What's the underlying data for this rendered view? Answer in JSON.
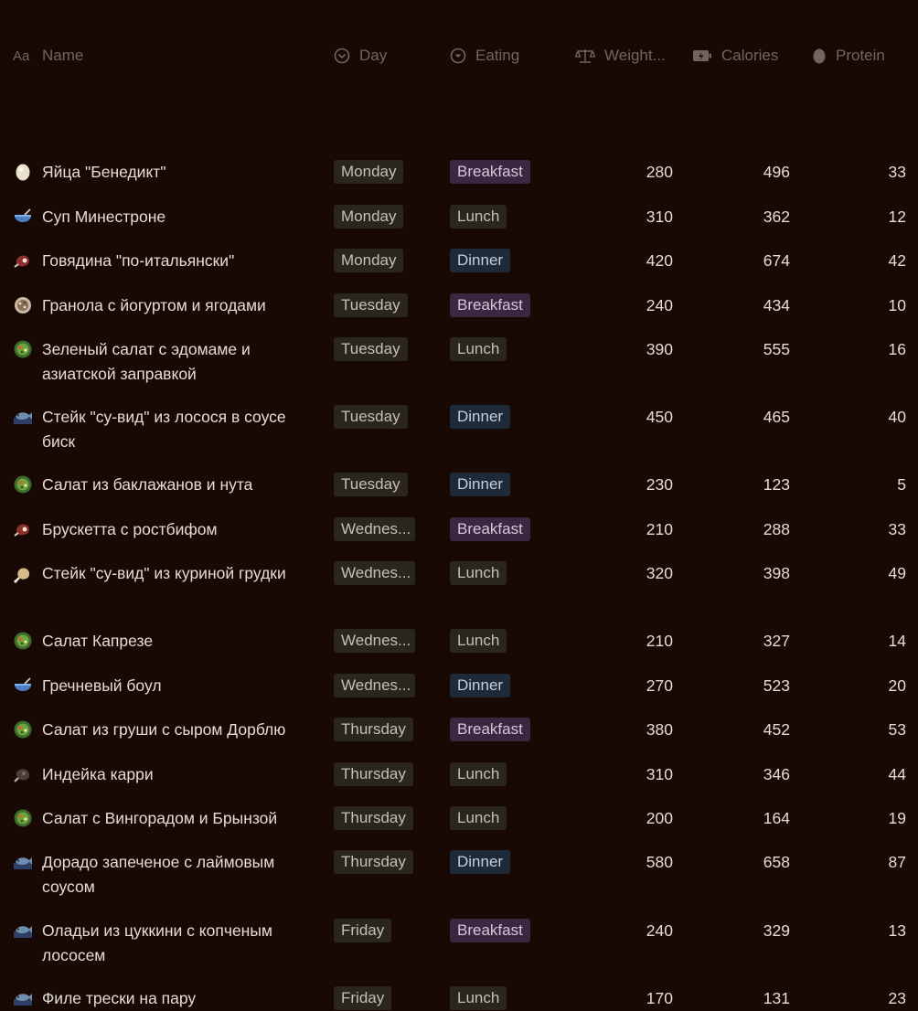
{
  "header": {
    "name": "Name",
    "day": "Day",
    "eating": "Eating",
    "weight": "Weight...",
    "calories": "Calories",
    "protein": "Protein"
  },
  "rows": [
    {
      "name": "Яйца \"Бенедикт\"",
      "icon": "egg-icon",
      "day": "Monday",
      "eating": "Breakfast",
      "weight": "280",
      "calories": "496",
      "protein": "33"
    },
    {
      "name": "Суп Минестроне",
      "icon": "soup-bowl-icon",
      "day": "Monday",
      "eating": "Lunch",
      "weight": "310",
      "calories": "362",
      "protein": "12"
    },
    {
      "name": "Говядина \"по-итальянски\"",
      "icon": "meat-icon",
      "day": "Monday",
      "eating": "Dinner",
      "weight": "420",
      "calories": "674",
      "protein": "42"
    },
    {
      "name": "Гранола с йогуртом и ягодами",
      "icon": "granola-icon",
      "day": "Tuesday",
      "eating": "Breakfast",
      "weight": "240",
      "calories": "434",
      "protein": "10"
    },
    {
      "name": "Зеленый салат с эдомаме и азиатской заправкой",
      "icon": "salad-icon",
      "day": "Tuesday",
      "eating": "Lunch",
      "weight": "390",
      "calories": "555",
      "protein": "16"
    },
    {
      "name": "Стейк \"су-вид\" из лосося в соусе биск",
      "icon": "fish-icon",
      "day": "Tuesday",
      "eating": "Dinner",
      "weight": "450",
      "calories": "465",
      "protein": "40"
    },
    {
      "name": "Салат из баклажанов и нута",
      "icon": "salad-icon",
      "day": "Tuesday",
      "eating": "Dinner",
      "weight": "230",
      "calories": "123",
      "protein": "5"
    },
    {
      "name": "Брускетта с ростбифом",
      "icon": "meat-icon",
      "day": "Wednes...",
      "eating": "Breakfast",
      "weight": "210",
      "calories": "288",
      "protein": "33"
    },
    {
      "name": "Стейк \"су-вид\" из куриной грудки",
      "icon": "chicken-icon",
      "day": "Wednes...",
      "eating": "Lunch",
      "weight": "320",
      "calories": "398",
      "protein": "49"
    },
    {
      "name": "Салат Капрезе",
      "icon": "salad-icon",
      "day": "Wednes...",
      "eating": "Lunch",
      "weight": "210",
      "calories": "327",
      "protein": "14"
    },
    {
      "name": "Гречневый боул",
      "icon": "soup-bowl-icon",
      "day": "Wednes...",
      "eating": "Dinner",
      "weight": "270",
      "calories": "523",
      "protein": "20"
    },
    {
      "name": "Салат из груши с сыром Дорблю",
      "icon": "salad-icon",
      "day": "Thursday",
      "eating": "Breakfast",
      "weight": "380",
      "calories": "452",
      "protein": "53"
    },
    {
      "name": "Индейка карри",
      "icon": "turkey-icon",
      "day": "Thursday",
      "eating": "Lunch",
      "weight": "310",
      "calories": "346",
      "protein": "44"
    },
    {
      "name": "Салат с Вингорадом и Брынзой",
      "icon": "salad-icon",
      "day": "Thursday",
      "eating": "Lunch",
      "weight": "200",
      "calories": "164",
      "protein": "19"
    },
    {
      "name": "Дорадо запеченое с лаймовым соусом",
      "icon": "fish-icon",
      "day": "Thursday",
      "eating": "Dinner",
      "weight": "580",
      "calories": "658",
      "protein": "87"
    },
    {
      "name": "Оладьи из цуккини с копченым лососем",
      "icon": "fish-icon",
      "day": "Friday",
      "eating": "Breakfast",
      "weight": "240",
      "calories": "329",
      "protein": "13"
    },
    {
      "name": "Филе трески на пару",
      "icon": "fish-icon",
      "day": "Friday",
      "eating": "Lunch",
      "weight": "170",
      "calories": "131",
      "protein": "23"
    }
  ]
}
